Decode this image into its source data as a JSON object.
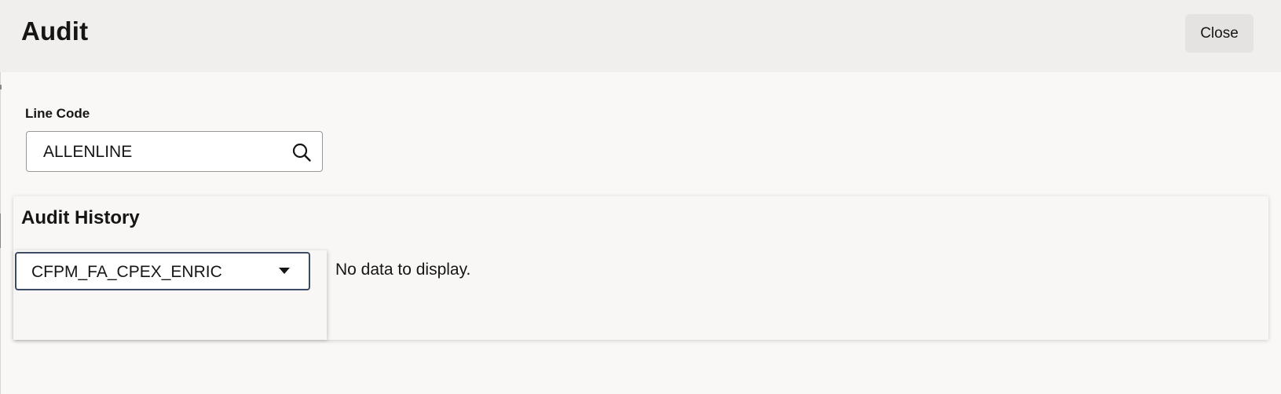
{
  "header": {
    "title": "Audit",
    "close_label": "Close"
  },
  "line_code": {
    "label": "Line Code",
    "value": "ALLENLINE",
    "icon": "search-icon"
  },
  "audit_history": {
    "title": "Audit History",
    "select_value": "CFPM_FA_CPEX_ENRIC",
    "select_icon": "chevron-down-icon",
    "empty_message": "No data to display."
  }
}
